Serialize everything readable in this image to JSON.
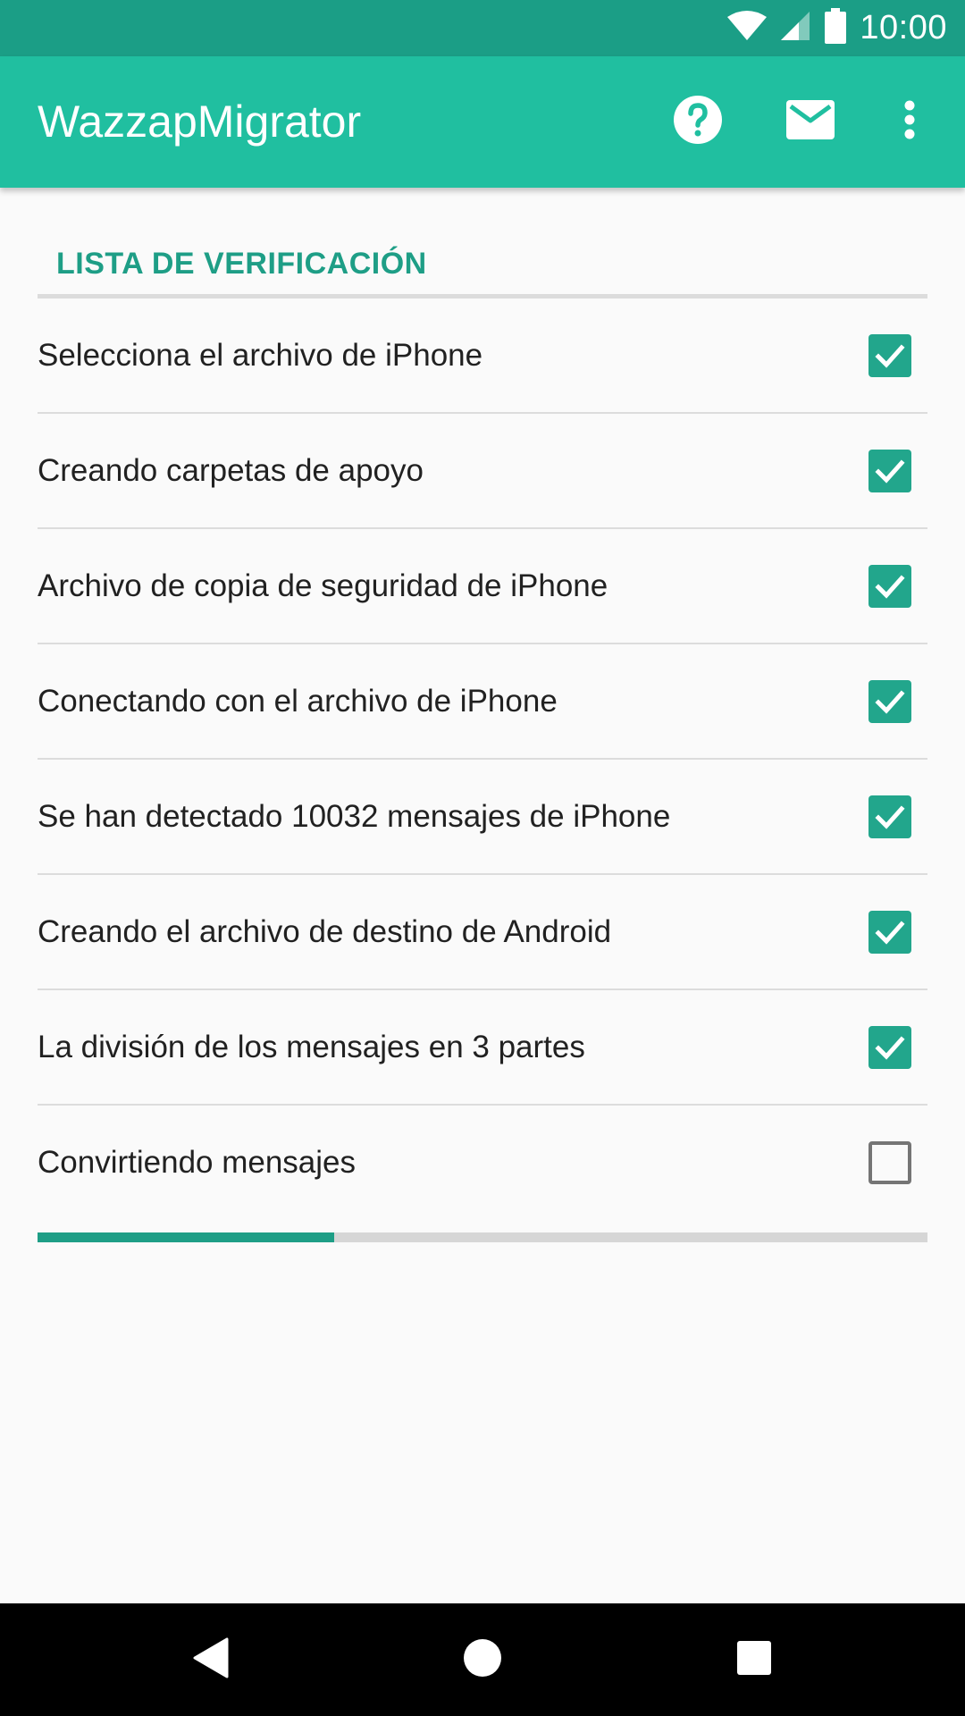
{
  "status_bar": {
    "time": "10:00",
    "icons": [
      "wifi-icon",
      "cell-signal-icon",
      "battery-icon"
    ]
  },
  "app_bar": {
    "title": "WazzapMigrator",
    "actions": [
      "help-icon",
      "mail-icon",
      "more-vert-icon"
    ]
  },
  "checklist": {
    "header": "LISTA DE VERIFICACIÓN",
    "items": [
      {
        "label": "Selecciona el archivo de iPhone",
        "checked": true
      },
      {
        "label": "Creando carpetas de apoyo",
        "checked": true
      },
      {
        "label": "Archivo de copia de seguridad de iPhone",
        "checked": true
      },
      {
        "label": "Conectando con el archivo de iPhone",
        "checked": true
      },
      {
        "label": "Se han detectado 10032 mensajes de iPhone",
        "checked": true
      },
      {
        "label": "Creando el archivo de destino de Android",
        "checked": true
      },
      {
        "label": "La división de los mensajes en 3 partes",
        "checked": true
      },
      {
        "label": "Convirtiendo mensajes",
        "checked": false
      }
    ]
  },
  "progress": {
    "fraction": 0.333
  },
  "nav_bar": {
    "buttons": [
      "back-icon",
      "home-icon",
      "recents-icon"
    ]
  },
  "colors": {
    "status_bar": "#1b9e86",
    "app_bar": "#20bfa0",
    "accent": "#1e9e86",
    "checkbox_checked": "#22a68c",
    "checkbox_unchecked": "#757575",
    "background": "#fafafa"
  }
}
